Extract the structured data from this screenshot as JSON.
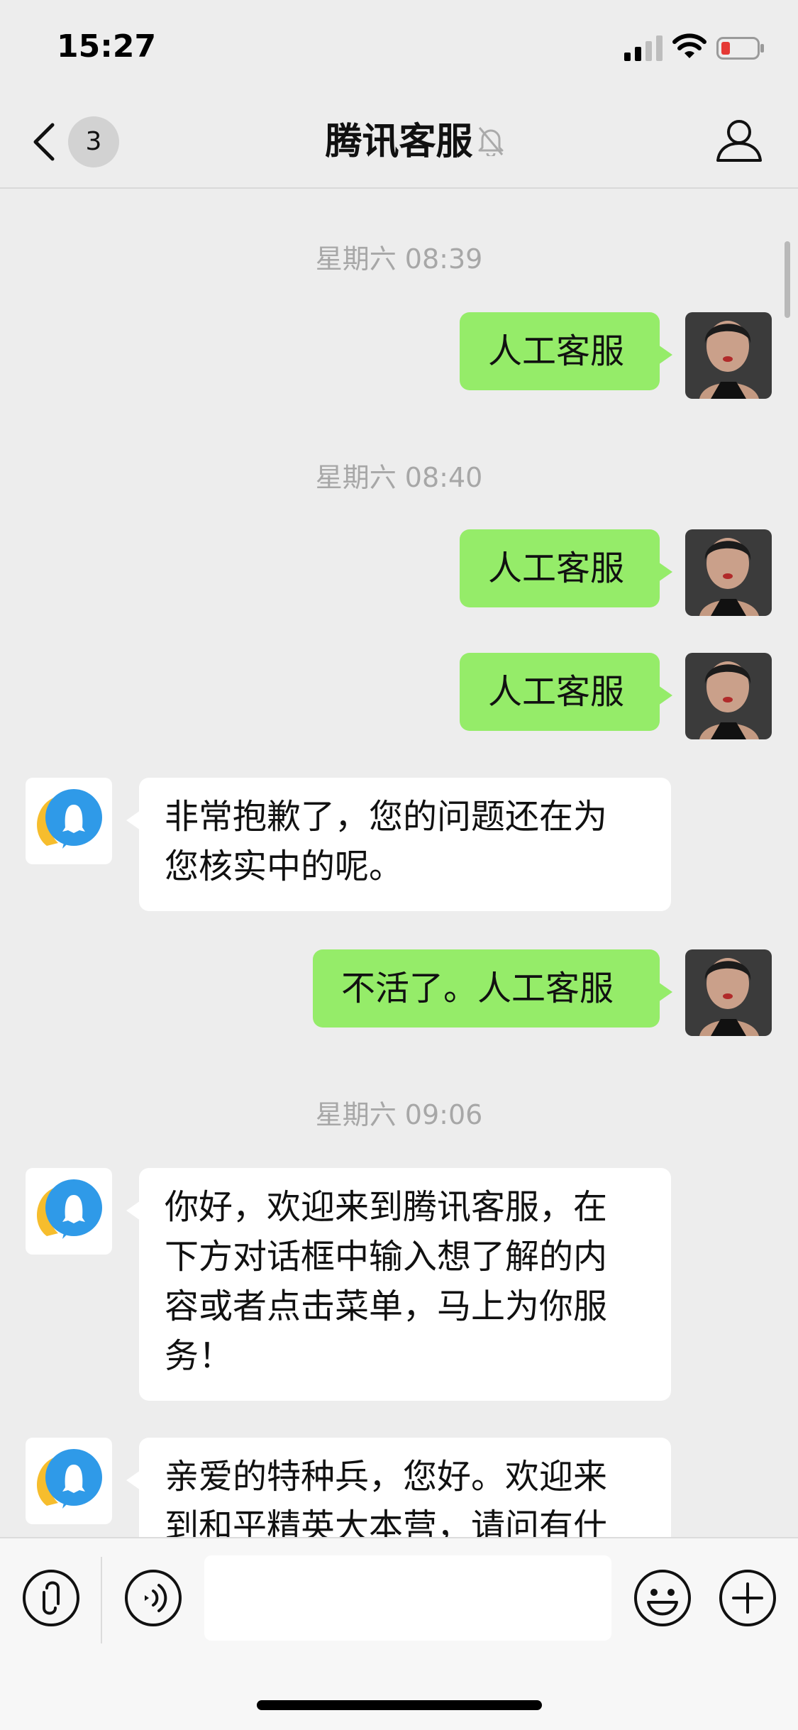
{
  "status_bar": {
    "time": "15:27"
  },
  "nav": {
    "back_badge": "3",
    "title": "腾讯客服"
  },
  "messages": [
    {
      "type": "time",
      "text": "星期六 08:39"
    },
    {
      "type": "sent",
      "text": "人工客服"
    },
    {
      "type": "time",
      "text": "星期六 08:40"
    },
    {
      "type": "sent",
      "text": "人工客服"
    },
    {
      "type": "sent",
      "text": "人工客服"
    },
    {
      "type": "received",
      "lines": [
        "非常抱歉了，您的问题还在为",
        "您核实中的呢。"
      ]
    },
    {
      "type": "sent",
      "text": "不活了。人工客服"
    },
    {
      "type": "time",
      "text": "星期六 09:06"
    },
    {
      "type": "received",
      "lines": [
        "你好，欢迎来到腾讯客服，在",
        "下方对话框中输入想了解的内",
        "容或者点击菜单，马上为你服",
        "务！"
      ]
    },
    {
      "type": "received",
      "lines": [
        "亲爱的特种兵，您好。欢迎来",
        "到和平精英大本营，请问有什"
      ]
    }
  ],
  "input_bar": {
    "text_value": ""
  },
  "colors": {
    "sent_bubble": "#95ec69",
    "received_bubble": "#ffffff",
    "background": "#ededed"
  },
  "icons": [
    "back-icon",
    "mute-icon",
    "profile-icon",
    "mini-program-icon",
    "voice-icon",
    "emoji-icon",
    "plus-icon"
  ]
}
